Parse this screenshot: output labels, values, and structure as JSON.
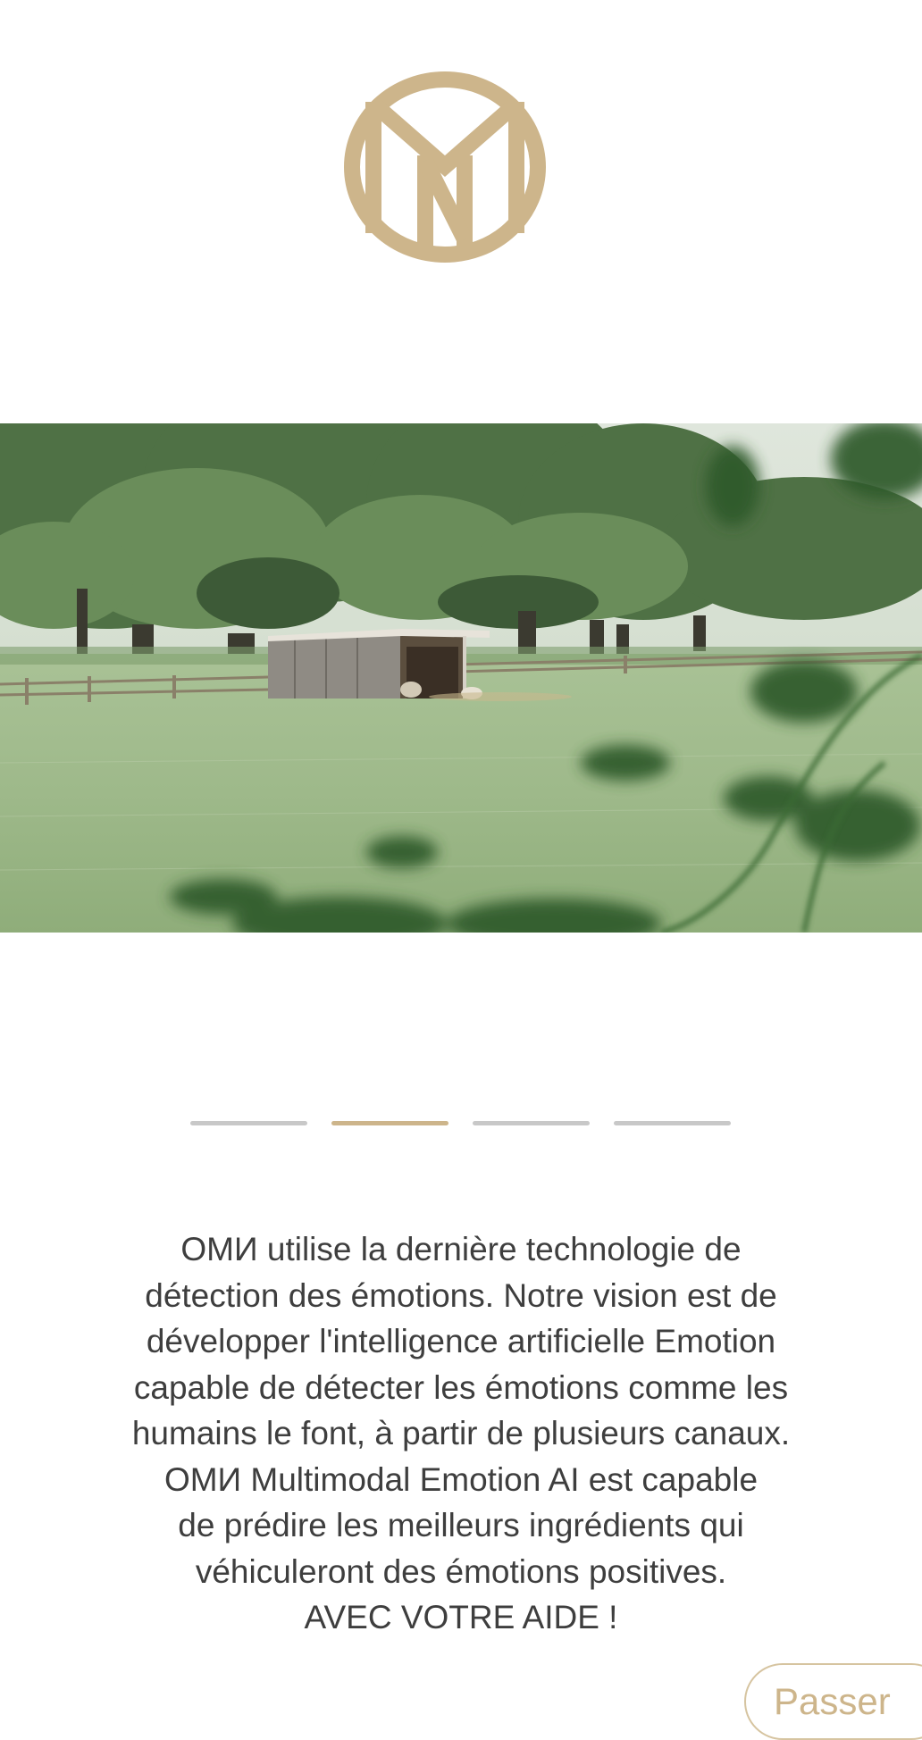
{
  "brand": {
    "logo_icon": "omi-monogram-logo",
    "accent_color": "#cdb58b"
  },
  "hero": {
    "image_icon": "pasture-with-barn-photo"
  },
  "pager": {
    "total": 4,
    "active_index": 1,
    "active_color": "#cdb58b",
    "inactive_color": "#c8c8c8"
  },
  "description": {
    "lines": [
      "ОМИ utilise la dernière technologie de",
      "détection des émotions. Notre vision est de",
      "développer l'intelligence artificielle Emotion",
      "capable de détecter les émotions comme les",
      "humains le font, à partir de plusieurs canaux.",
      "ОМИ Multimodal Emotion AI est capable",
      "de prédire les meilleurs ingrédients qui",
      "véhiculeront des émotions positives.",
      "AVEC VOTRE AIDE !"
    ]
  },
  "skip_button": {
    "label": "Passer"
  }
}
